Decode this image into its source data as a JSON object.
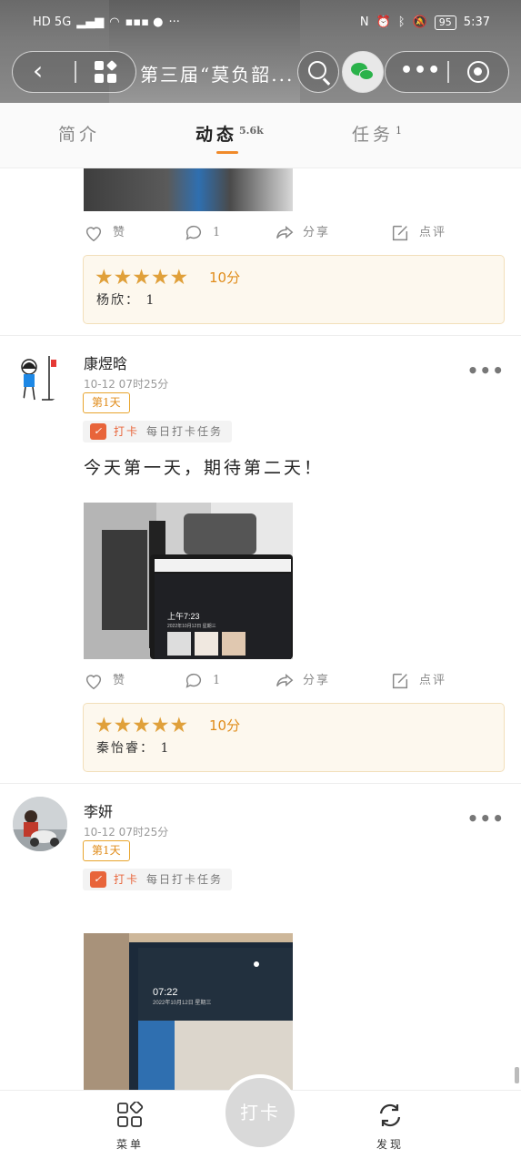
{
  "status_bar": {
    "left_text": "HD 5G",
    "battery": "95",
    "time": "5:37"
  },
  "header": {
    "title": "第三届“莫负韶..."
  },
  "tabs": [
    {
      "label": "简介",
      "badge": ""
    },
    {
      "label": "动态",
      "badge": "5.6k"
    },
    {
      "label": "任务",
      "badge": "1"
    }
  ],
  "actions": {
    "like": "赞",
    "comment_count": "1",
    "share": "分享",
    "review": "点评"
  },
  "posts": [
    {
      "rating": {
        "stars": "★★★★★",
        "score": "10分",
        "rater": "杨欣： 1"
      }
    },
    {
      "username": "康煜晗",
      "time": "10-12 07时25分",
      "day_tag": "第1天",
      "task_kind": "打卡",
      "task_name": "每日打卡任务",
      "content": "今天第一天，期待第二天！",
      "photo_text": {
        "clock": "上午7:23",
        "date": "2022年10月12日 星期三"
      },
      "rating": {
        "stars": "★★★★★",
        "score": "10分",
        "rater": "秦怡睿： 1"
      }
    },
    {
      "username": "李妍",
      "time": "10-12 07时25分",
      "day_tag": "第1天",
      "task_kind": "打卡",
      "task_name": "每日打卡任务",
      "photo_text": {
        "clock": "07:22",
        "date": "2022年10月12日 星期三"
      }
    }
  ],
  "bottom_bar": {
    "menu": "菜单",
    "checkin": "打卡",
    "discover": "发现"
  }
}
